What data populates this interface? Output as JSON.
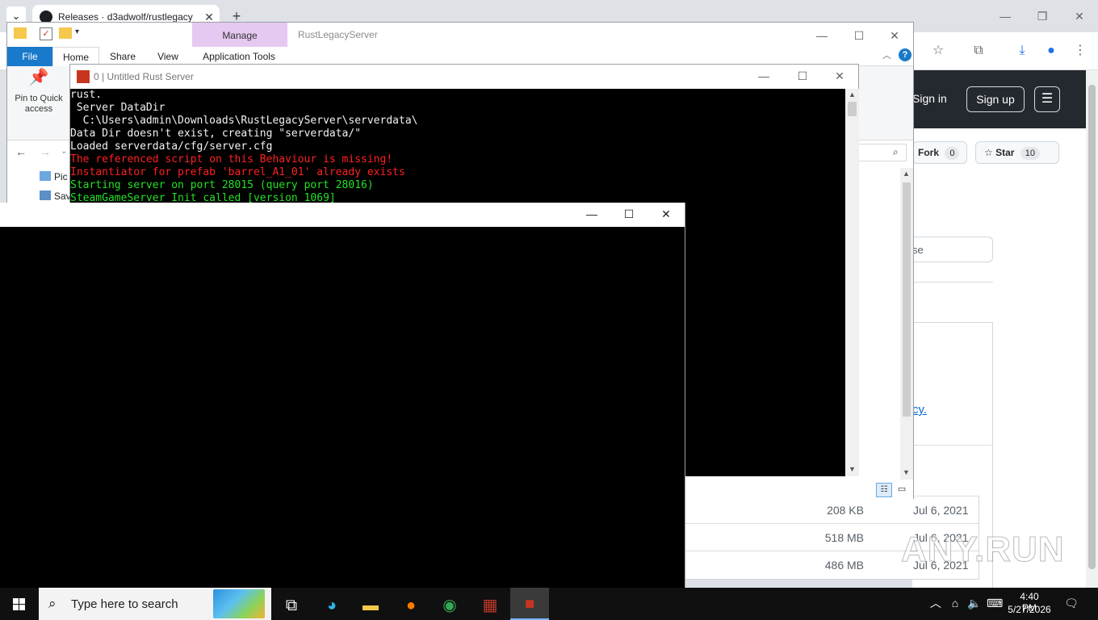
{
  "chrome": {
    "tab_title": "Releases · d3adwolf/rustlegacy",
    "tab_close": "✕",
    "new_tab": "+",
    "github": {
      "sign_in": "Sign in",
      "sign_up": "Sign up",
      "fork_label": "Fork",
      "fork_count": "0",
      "star_label": "Star",
      "star_count": "10",
      "partial_input_text": "se",
      "partial_link_text": "cy."
    }
  },
  "explorer": {
    "title": "RustLegacyServer",
    "manage_tab": "Manage",
    "tabs": [
      "File",
      "Home",
      "Share",
      "View",
      "Application Tools"
    ],
    "pin_label": "Pin to Quick access",
    "sidebar": [
      "Pic",
      "Sav"
    ]
  },
  "assets": [
    {
      "size": "208 KB",
      "date": "Jul 6, 2021"
    },
    {
      "size": "518 MB",
      "date": "Jul 6, 2021"
    },
    {
      "size": "486 MB",
      "date": "Jul 6, 2021"
    }
  ],
  "rust_window": {
    "title": "0 | Untitled Rust Server",
    "lines": [
      {
        "text": "rust.",
        "color": "white"
      },
      {
        "text": " Server DataDir",
        "color": "white"
      },
      {
        "text": "  C:\\Users\\admin\\Downloads\\RustLegacyServer\\serverdata\\",
        "color": "white"
      },
      {
        "text": "Data Dir doesn't exist, creating \"serverdata/\"",
        "color": "white"
      },
      {
        "text": "Loaded serverdata/cfg/server.cfg",
        "color": "white"
      },
      {
        "text": "The referenced script on this Behaviour is missing!",
        "color": "red"
      },
      {
        "text": "Instantiator for prefab 'barrel_A1_01' already exists",
        "color": "red"
      },
      {
        "text": "Starting server on port 28015 (query port 28016)",
        "color": "green"
      },
      {
        "text": "SteamGameServer_Init called [version 1069]",
        "color": "green"
      }
    ]
  },
  "taskbar": {
    "search_placeholder": "Type here to search",
    "time": "4:40 PM",
    "date": "5/27/2026"
  },
  "watermark": "ANY.RUN"
}
